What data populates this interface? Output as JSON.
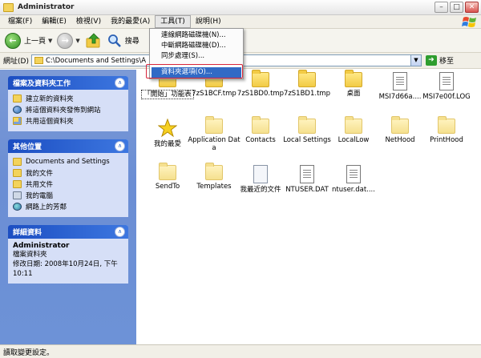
{
  "window": {
    "title": "Administrator"
  },
  "menubar": {
    "items": [
      "檔案(F)",
      "編輯(E)",
      "檢視(V)",
      "我的最愛(A)",
      "工具(T)",
      "說明(H)"
    ]
  },
  "toolbar": {
    "back_label": "上一頁",
    "search_label": "搜尋"
  },
  "addressbar": {
    "label": "網址(D)",
    "path": "C:\\Documents and Settings\\Administrator",
    "go_label": "移至"
  },
  "tools_menu": {
    "items": [
      "連線網路磁碟機(N)...",
      "中斷網路磁碟機(D)...",
      "同步處理(S)..."
    ],
    "highlighted": "資料夾選項(O)..."
  },
  "left_pane": {
    "tasks": {
      "title": "檔案及資料夾工作",
      "links": [
        "建立新的資料夾",
        "將這個資料夾發佈到網站",
        "共用這個資料夾"
      ]
    },
    "places": {
      "title": "其他位置",
      "links": [
        "Documents and Settings",
        "我的文件",
        "共用文件",
        "我的電腦",
        "網路上的芳鄰"
      ]
    },
    "details": {
      "title": "詳細資料",
      "name": "Administrator",
      "type": "檔案資料夾",
      "modified": "修改日期: 2008年10月24日, 下午",
      "time": "10:11"
    }
  },
  "files": [
    {
      "label": "「開始」功能表",
      "icon": "folder"
    },
    {
      "label": "7zS1BCF.tmp",
      "icon": "folder"
    },
    {
      "label": "7zS1BD0.tmp",
      "icon": "folder"
    },
    {
      "label": "7zS1BD1.tmp",
      "icon": "folder"
    },
    {
      "label": "桌面",
      "icon": "folder"
    },
    {
      "label": "MSI7d66a....",
      "icon": "doc"
    },
    {
      "label": "MSI7e00f.LOG",
      "icon": "doc"
    },
    {
      "label": "我的最愛",
      "icon": "star"
    },
    {
      "label": "Application Data",
      "icon": "folder-pale"
    },
    {
      "label": "Contacts",
      "icon": "folder-pale"
    },
    {
      "label": "Local Settings",
      "icon": "folder-pale"
    },
    {
      "label": "LocalLow",
      "icon": "folder-pale"
    },
    {
      "label": "NetHood",
      "icon": "folder-pale"
    },
    {
      "label": "PrintHood",
      "icon": "folder-pale"
    },
    {
      "label": "SendTo",
      "icon": "folder-pale"
    },
    {
      "label": "Templates",
      "icon": "folder-pale"
    },
    {
      "label": "我最近的文件",
      "icon": "recent"
    },
    {
      "label": "NTUSER.DAT",
      "icon": "doc"
    },
    {
      "label": "ntuser.dat....",
      "icon": "doc"
    }
  ],
  "statusbar": {
    "text": "讀取變更設定。"
  }
}
